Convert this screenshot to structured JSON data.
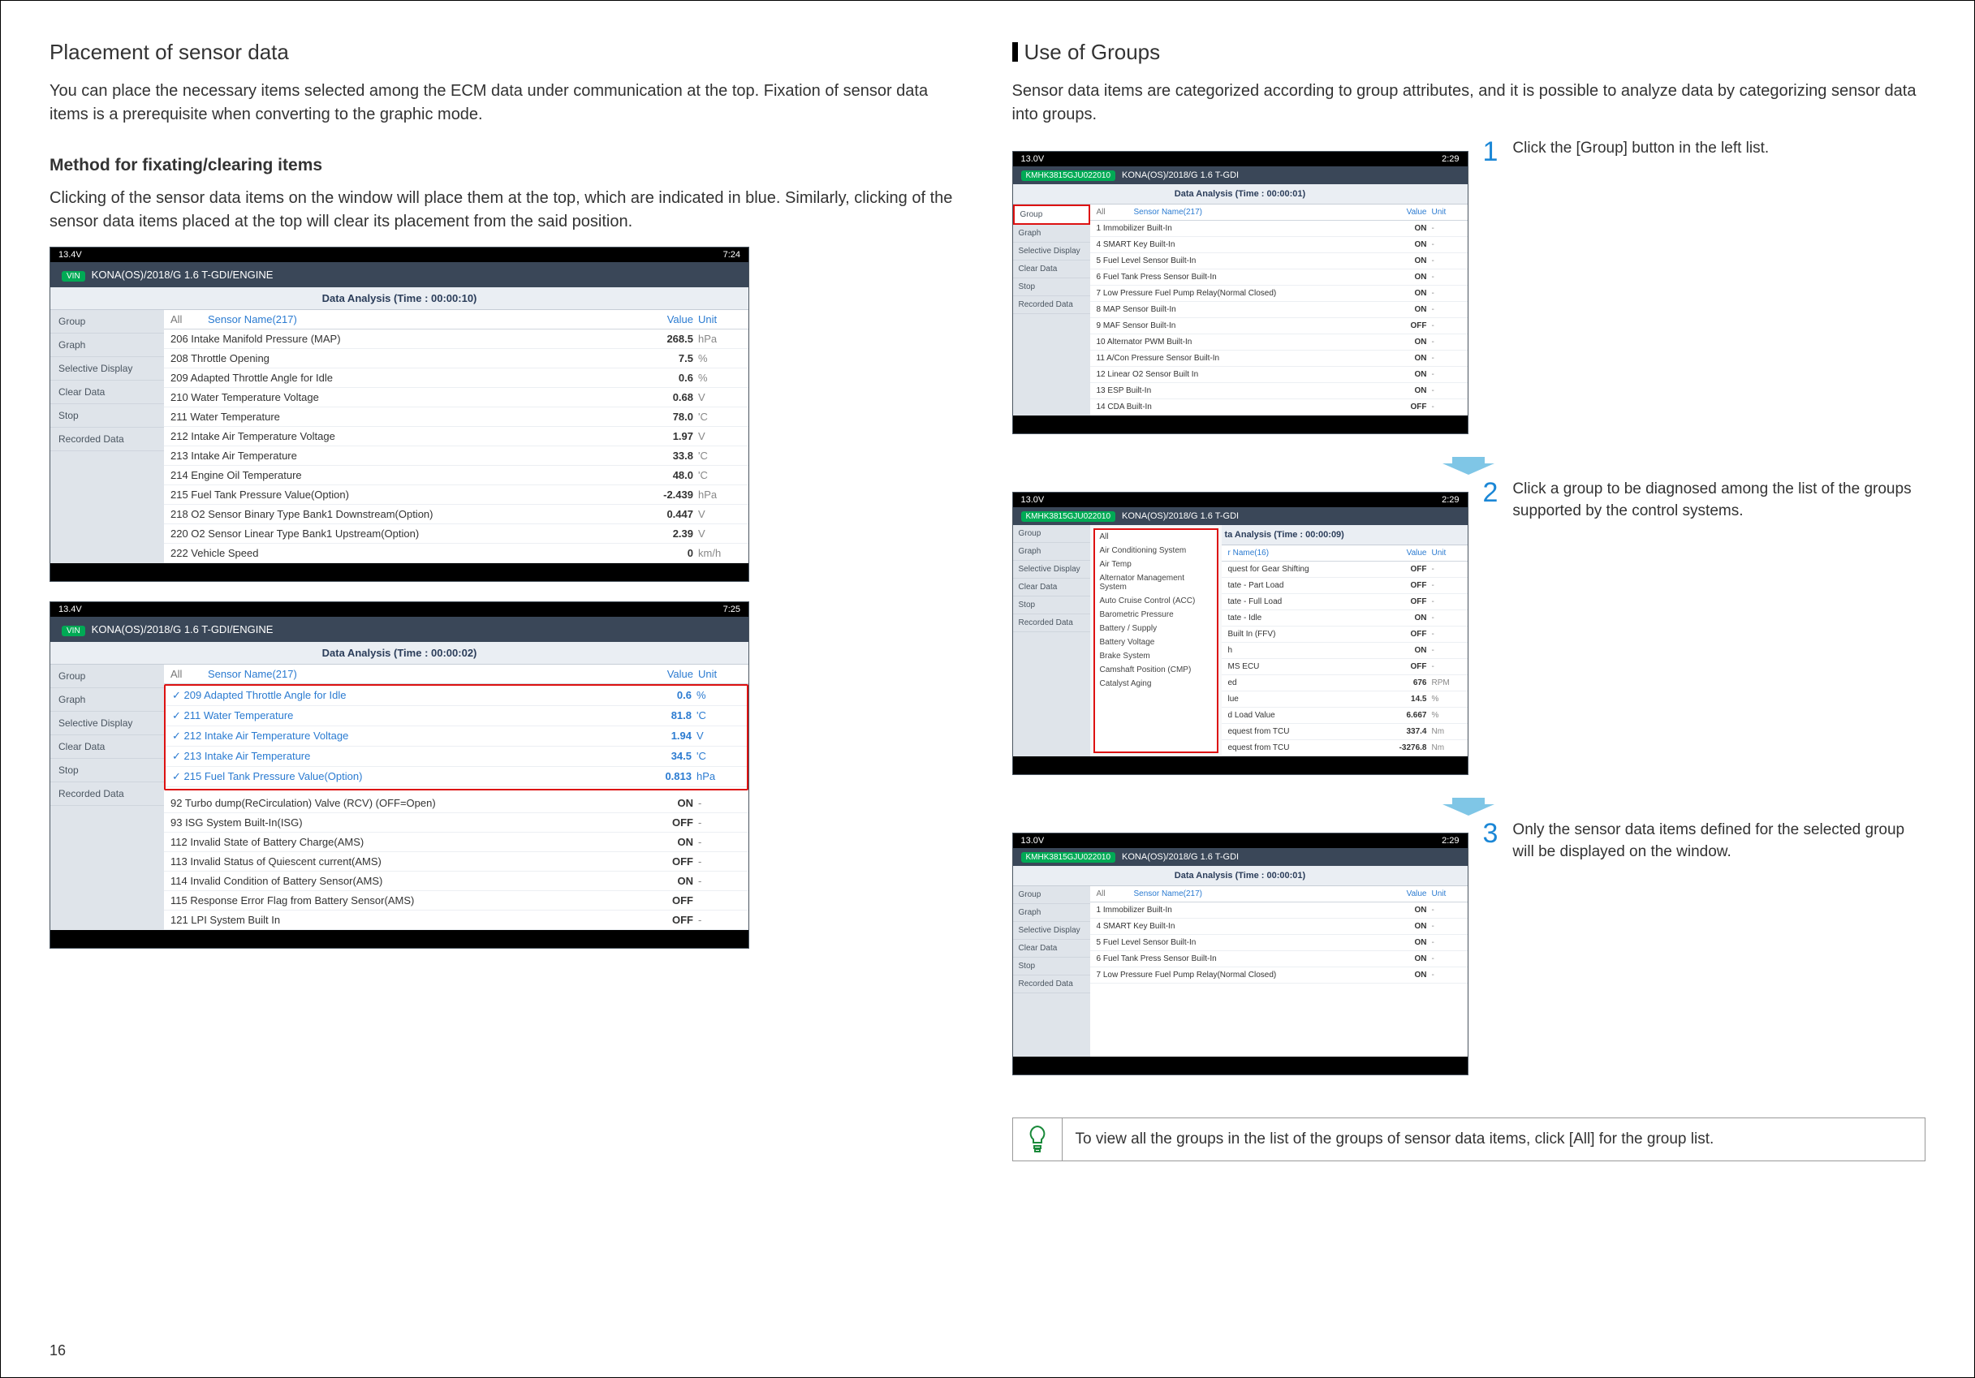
{
  "page_number": "16",
  "left": {
    "title": "Placement of sensor data",
    "intro": "You can place the necessary items selected among the ECM data under communication at the top. Fixation of sensor data items is a prerequisite when converting to the graphic mode.",
    "method_title": "Method for fixating/clearing items",
    "method_body": "Clicking of the sensor data items on the window will place them at the top, which are indicated in blue. Similarly, clicking of the sensor data items placed at the top will clear its placement from the said position."
  },
  "shot_common": {
    "voltage": "13.4V",
    "time_a": "7:24",
    "time_b": "7:25",
    "vin_label": "VIN",
    "vehicle": "KONA(OS)/2018/G 1.6 T-GDI/ENGINE",
    "analysis_a": "Data Analysis (Time : 00:00:10)",
    "analysis_b": "Data Analysis (Time : 00:00:02)",
    "all": "All",
    "sensor_name": "Sensor Name(217)",
    "value": "Value",
    "unit": "Unit",
    "side": [
      "Group",
      "Graph",
      "Selective Display",
      "Clear Data",
      "Stop",
      "Recorded Data"
    ]
  },
  "shot1_rows": [
    {
      "n": "206 Intake Manifold Pressure (MAP)",
      "v": "268.5",
      "u": "hPa"
    },
    {
      "n": "208 Throttle Opening",
      "v": "7.5",
      "u": "%"
    },
    {
      "n": "209 Adapted Throttle Angle for Idle",
      "v": "0.6",
      "u": "%"
    },
    {
      "n": "210 Water Temperature Voltage",
      "v": "0.68",
      "u": "V"
    },
    {
      "n": "211 Water Temperature",
      "v": "78.0",
      "u": "'C"
    },
    {
      "n": "212 Intake Air Temperature Voltage",
      "v": "1.97",
      "u": "V"
    },
    {
      "n": "213 Intake Air Temperature",
      "v": "33.8",
      "u": "'C"
    },
    {
      "n": "214 Engine Oil Temperature",
      "v": "48.0",
      "u": "'C"
    },
    {
      "n": "215 Fuel Tank Pressure Value(Option)",
      "v": "-2.439",
      "u": "hPa"
    },
    {
      "n": "218 O2 Sensor Binary Type Bank1 Downstream(Option)",
      "v": "0.447",
      "u": "V"
    },
    {
      "n": "220 O2 Sensor Linear Type Bank1 Upstream(Option)",
      "v": "2.39",
      "u": "V"
    },
    {
      "n": "222 Vehicle Speed",
      "v": "0",
      "u": "km/h"
    }
  ],
  "shot2_pinned": [
    {
      "n": "209 Adapted Throttle Angle for Idle",
      "v": "0.6",
      "u": "%"
    },
    {
      "n": "211 Water Temperature",
      "v": "81.8",
      "u": "'C"
    },
    {
      "n": "212 Intake Air Temperature Voltage",
      "v": "1.94",
      "u": "V"
    },
    {
      "n": "213 Intake Air Temperature",
      "v": "34.5",
      "u": "'C"
    },
    {
      "n": "215 Fuel Tank Pressure Value(Option)",
      "v": "0.813",
      "u": "hPa"
    }
  ],
  "shot2_rows": [
    {
      "n": "92 Turbo dump(ReCirculation) Valve (RCV) (OFF=Open)",
      "v": "ON",
      "u": "-"
    },
    {
      "n": "93 ISG System Built-In(ISG)",
      "v": "OFF",
      "u": "-"
    },
    {
      "n": "112 Invalid State of Battery Charge(AMS)",
      "v": "ON",
      "u": "-"
    },
    {
      "n": "113 Invalid Status of Quiescent current(AMS)",
      "v": "OFF",
      "u": "-"
    },
    {
      "n": "114 Invalid Condition of Battery Sensor(AMS)",
      "v": "ON",
      "u": "-"
    },
    {
      "n": "115 Response Error Flag from Battery Sensor(AMS)",
      "v": "OFF",
      "u": ""
    },
    {
      "n": "121 LPI System Built In",
      "v": "OFF",
      "u": "-"
    }
  ],
  "right": {
    "title": "Use of Groups",
    "intro": "Sensor data items are categorized according to group attributes, and it is possible to analyze data by categorizing sensor data into groups.",
    "steps": [
      {
        "num": "1",
        "txt": "Click the [Group] button in the left list."
      },
      {
        "num": "2",
        "txt": "Click a group to be diagnosed among the list of the groups supported by the control systems."
      },
      {
        "num": "3",
        "txt": "Only the sensor data items defined for the selected group will be displayed on the window."
      }
    ],
    "tip": "To view all the groups in the list of the groups of sensor data items, click [All] for the group list."
  },
  "rightshot": {
    "voltage": "13.0V",
    "time": "2:29",
    "vehicle": "KONA(OS)/2018/G 1.6 T-GDI",
    "vin": "KMHK3815GJU022010",
    "analysis1": "Data Analysis (Time : 00:00:01)",
    "analysis2": "ta Analysis (Time : 00:00:09)",
    "analysis3": "Data Analysis (Time : 00:00:01)",
    "sensor_name16": "r Name(16)"
  },
  "rshot1_rows": [
    {
      "n": "1 Immobilizer Built-In",
      "v": "ON",
      "u": "-"
    },
    {
      "n": "4 SMART Key Built-In",
      "v": "ON",
      "u": "-"
    },
    {
      "n": "5 Fuel Level Sensor Built-In",
      "v": "ON",
      "u": "-"
    },
    {
      "n": "6 Fuel Tank Press Sensor Built-In",
      "v": "ON",
      "u": "-"
    },
    {
      "n": "7 Low Pressure Fuel Pump Relay(Normal Closed)",
      "v": "ON",
      "u": "-"
    },
    {
      "n": "8 MAP Sensor Built-In",
      "v": "ON",
      "u": "-"
    },
    {
      "n": "9 MAF Sensor Built-In",
      "v": "OFF",
      "u": "-"
    },
    {
      "n": "10 Alternator PWM Built-In",
      "v": "ON",
      "u": "-"
    },
    {
      "n": "11 A/Con Pressure Sensor Built-In",
      "v": "ON",
      "u": "-"
    },
    {
      "n": "12 Linear O2 Sensor Built In",
      "v": "ON",
      "u": "-"
    },
    {
      "n": "13 ESP Built-In",
      "v": "ON",
      "u": "-"
    },
    {
      "n": "14 CDA Built-In",
      "v": "OFF",
      "u": "-"
    }
  ],
  "rshot2_groups": [
    "All",
    "Air Conditioning System",
    "Air Temp",
    "Alternator Management System",
    "Auto Cruise Control (ACC)",
    "Barometric Pressure",
    "Battery / Supply",
    "Battery Voltage",
    "Brake System",
    "Camshaft Position (CMP)",
    "Catalyst Aging"
  ],
  "rshot2_rows": [
    {
      "n": "quest for Gear Shifting",
      "v": "OFF",
      "u": "-"
    },
    {
      "n": "tate - Part Load",
      "v": "OFF",
      "u": "-"
    },
    {
      "n": "tate - Full Load",
      "v": "OFF",
      "u": "-"
    },
    {
      "n": "tate - Idle",
      "v": "ON",
      "u": "-"
    },
    {
      "n": "Built In (FFV)",
      "v": "OFF",
      "u": "-"
    },
    {
      "n": "h",
      "v": "ON",
      "u": "-"
    },
    {
      "n": "MS ECU",
      "v": "OFF",
      "u": "-"
    },
    {
      "n": "ed",
      "v": "676",
      "u": "RPM"
    },
    {
      "n": "lue",
      "v": "14.5",
      "u": "%"
    },
    {
      "n": "d Load Value",
      "v": "6.667",
      "u": "%"
    },
    {
      "n": "equest from TCU",
      "v": "337.4",
      "u": "Nm"
    },
    {
      "n": "equest from TCU",
      "v": "-3276.8",
      "u": "Nm"
    }
  ],
  "rshot3_rows": [
    {
      "n": "1 Immobilizer Built-In",
      "v": "ON",
      "u": "-"
    },
    {
      "n": "4 SMART Key Built-In",
      "v": "ON",
      "u": "-"
    },
    {
      "n": "5 Fuel Level Sensor Built-In",
      "v": "ON",
      "u": "-"
    },
    {
      "n": "6 Fuel Tank Press Sensor Built-In",
      "v": "ON",
      "u": "-"
    },
    {
      "n": "7 Low Pressure Fuel Pump Relay(Normal Closed)",
      "v": "ON",
      "u": "-"
    }
  ]
}
